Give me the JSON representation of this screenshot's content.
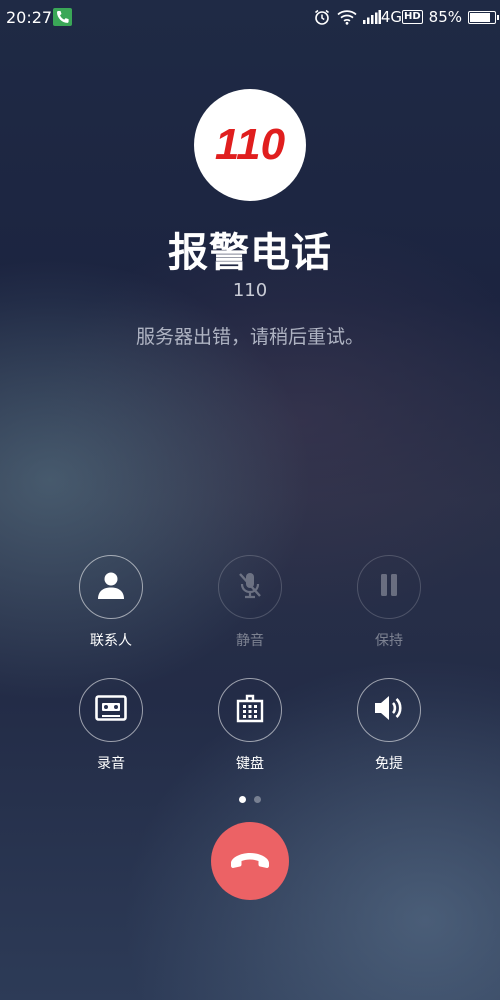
{
  "status_bar": {
    "time": "20:27",
    "network": "4G",
    "hd": "HD",
    "battery_percent": "85%",
    "battery_level": 0.85,
    "icons": [
      "phone-call-icon",
      "alarm-icon",
      "wifi-icon",
      "signal-icon",
      "battery-icon"
    ]
  },
  "caller": {
    "avatar_text": "110",
    "avatar_color": "#e01e1e",
    "name": "报警电话",
    "number": "110",
    "status": "服务器出错，请稍后重试。"
  },
  "controls": {
    "contacts": {
      "label": "联系人",
      "icon": "person-icon",
      "enabled": true
    },
    "mute": {
      "label": "静音",
      "icon": "mic-off-icon",
      "enabled": false
    },
    "hold": {
      "label": "保持",
      "icon": "pause-icon",
      "enabled": false
    },
    "record": {
      "label": "录音",
      "icon": "tape-recorder-icon",
      "enabled": true
    },
    "keypad": {
      "label": "键盘",
      "icon": "dialpad-icon",
      "enabled": true
    },
    "speaker": {
      "label": "免提",
      "icon": "speaker-icon",
      "enabled": true
    }
  },
  "pager": {
    "pages": 2,
    "current": 1
  },
  "hangup": {
    "icon": "end-call-icon",
    "color": "#ec6265"
  }
}
